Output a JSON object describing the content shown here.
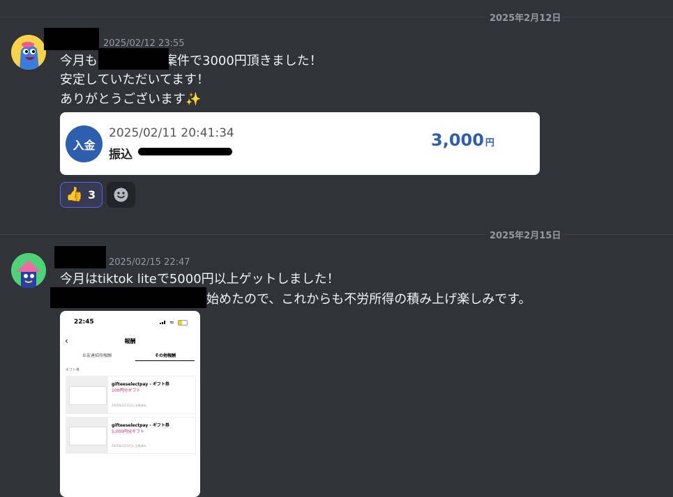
{
  "dates": {
    "first": "2025年2月12日",
    "second": "2025年2月15日"
  },
  "message1": {
    "timestamp": "2025/02/12 23:55",
    "line1_a": "今月も",
    "line1_b": "案件で3000円頂きました！",
    "line2": "安定していただいてます！",
    "line3": "ありがとうございます",
    "sparkle": "✨"
  },
  "deposit_card": {
    "badge": "入金",
    "datetime": "2025/02/11 20:41:34",
    "label": "振込",
    "amount": "3,000",
    "unit": "円"
  },
  "reactions": {
    "thumbs": "👍",
    "count": "3"
  },
  "message2": {
    "timestamp": "2025/02/15 22:47",
    "line1": "今月はtiktok liteで5000円以上ゲットしました！",
    "line2": "始めたので、これからも不労所得の積み上げ楽しみです。"
  },
  "phone": {
    "time": "22:45",
    "title": "報酬",
    "tab1": "お友達招待報酬",
    "tab2": "その他報酬",
    "section": "ギフト券",
    "items": [
      {
        "name": "gifteeselectpay - ギフト券",
        "amount": "100円分ギフト",
        "date": "2025年2月15日に交換済み"
      },
      {
        "name": "gifteeselectpay - ギフト券",
        "amount": "5,000円分ギフト",
        "date": "2025年2月10日に交換済み"
      }
    ]
  },
  "colors": {
    "background": "#313338",
    "accent": "#2e5eae",
    "reaction_border": "#5865f2",
    "gift_red": "#e0245e"
  }
}
